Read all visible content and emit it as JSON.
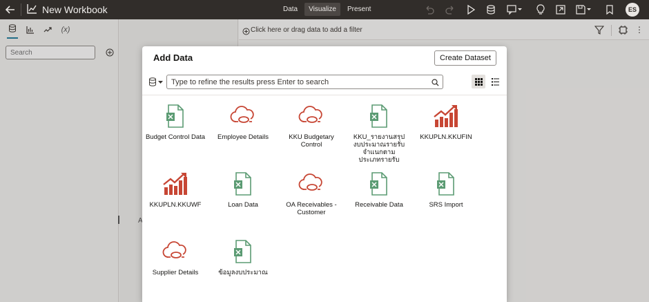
{
  "app": {
    "title": "New Workbook",
    "modes": [
      {
        "label": "Data",
        "active": false
      },
      {
        "label": "Visualize",
        "active": true
      },
      {
        "label": "Present",
        "active": false
      }
    ],
    "user_initials": "ES"
  },
  "left_panel": {
    "search_placeholder": "Search",
    "mid_letter": "A"
  },
  "filter_bar": {
    "text": "Click here or drag data to add a filter"
  },
  "dialog": {
    "title": "Add Data",
    "create_label": "Create Dataset",
    "search_placeholder": "Type to refine the results press Enter to search",
    "items": [
      {
        "label": "Budget Control Data",
        "icon": "excel-file-icon"
      },
      {
        "label": "Employee Details",
        "icon": "cloud-db-icon"
      },
      {
        "label": "KKU Budgetary Control",
        "icon": "cloud-db-icon"
      },
      {
        "label": "KKU_รายงานสรุปงบประมาณรายรับจำแนกตามประเภทรายรับ",
        "icon": "excel-file-icon"
      },
      {
        "label": "KKUPLN.KKUFIN",
        "icon": "analytics-chart-icon"
      },
      {
        "label": "KKUPLN.KKUWF",
        "icon": "analytics-chart-icon"
      },
      {
        "label": "Loan Data",
        "icon": "excel-file-icon"
      },
      {
        "label": "OA Receivables - Customer",
        "icon": "cloud-db-icon"
      },
      {
        "label": "Receivable Data",
        "icon": "excel-file-icon"
      },
      {
        "label": "SRS Import",
        "icon": "excel-file-icon"
      },
      {
        "label": "Supplier Details",
        "icon": "cloud-db-icon"
      },
      {
        "label": "ข้อมูลงบประมาณ",
        "icon": "excel-file-icon"
      }
    ]
  },
  "colors": {
    "excel": "#5b9b73",
    "cloud": "#c74634",
    "chart": "#c74634",
    "topbar": "#312d2a"
  }
}
